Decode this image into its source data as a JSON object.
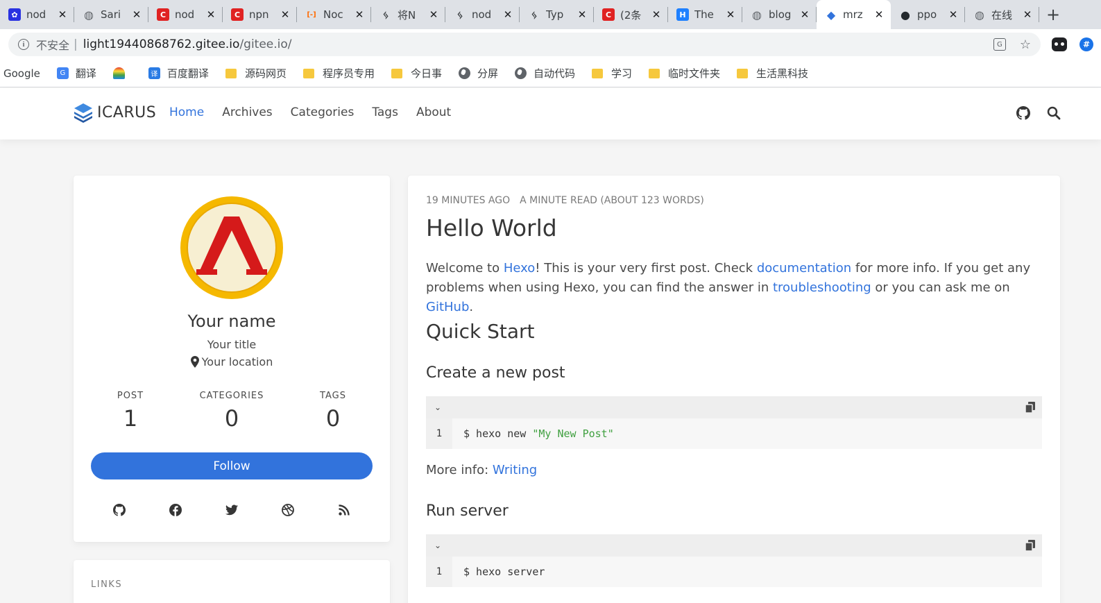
{
  "browser": {
    "tabs": [
      {
        "label": "nod",
        "icon": "baidu-paw-icon",
        "color": "#2932e1"
      },
      {
        "label": "Sari",
        "icon": "globe-icon",
        "color": "#5f6368"
      },
      {
        "label": "nod",
        "icon": "csdn-c-icon",
        "color": "#e02222"
      },
      {
        "label": "npn",
        "icon": "csdn-c-icon",
        "color": "#e02222"
      },
      {
        "label": "Noc",
        "icon": "bracket-icon",
        "color": "#ff6a00"
      },
      {
        "label": "将N",
        "icon": "yuque-bird-icon",
        "color": "#3c4043"
      },
      {
        "label": "nod",
        "icon": "yuque-bird-icon",
        "color": "#3c4043"
      },
      {
        "label": "Typ",
        "icon": "yuque-bird-icon",
        "color": "#3c4043"
      },
      {
        "label": "(2条",
        "icon": "csdn-c-icon",
        "color": "#e02222"
      },
      {
        "label": "The",
        "icon": "hex-h-icon",
        "color": "#1e80ff"
      },
      {
        "label": "blog",
        "icon": "globe-icon",
        "color": "#5f6368"
      },
      {
        "label": "mrz",
        "icon": "layers-icon",
        "color": "#3273dc"
      },
      {
        "label": "ppo",
        "icon": "github-icon",
        "color": "#24292e"
      },
      {
        "label": "在线",
        "icon": "globe-icon",
        "color": "#5f6368"
      }
    ],
    "active_tab": 11,
    "insecure_label": "不安全",
    "url_host": "light19440868762.gitee.io",
    "url_path": "/gitee.io/",
    "bookmarks": [
      {
        "label": "Google",
        "icon": "none"
      },
      {
        "label": "翻译",
        "icon": "google-translate-icon"
      },
      {
        "label": "",
        "icon": "rainbow-icon"
      },
      {
        "label": "百度翻译",
        "icon": "baidu-translate-icon"
      },
      {
        "label": "源码网页",
        "icon": "folder-icon"
      },
      {
        "label": "程序员专用",
        "icon": "folder-icon"
      },
      {
        "label": "今日事",
        "icon": "folder-icon"
      },
      {
        "label": "分屏",
        "icon": "globe-icon"
      },
      {
        "label": "自动代码",
        "icon": "globe-icon"
      },
      {
        "label": "学习",
        "icon": "folder-icon"
      },
      {
        "label": "临时文件夹",
        "icon": "folder-icon"
      },
      {
        "label": "生活黑科技",
        "icon": "folder-icon"
      }
    ]
  },
  "site": {
    "brand": "ICARUS",
    "nav": [
      "Home",
      "Archives",
      "Categories",
      "Tags",
      "About"
    ],
    "active_nav": 0,
    "accent_color": "#3273dc"
  },
  "profile": {
    "name": "Your name",
    "title": "Your title",
    "location": "Your location",
    "stats": [
      {
        "label": "POST",
        "value": "1"
      },
      {
        "label": "CATEGORIES",
        "value": "0"
      },
      {
        "label": "TAGS",
        "value": "0"
      }
    ],
    "follow_label": "Follow",
    "socials": [
      "github-icon",
      "facebook-icon",
      "twitter-icon",
      "dribbble-icon",
      "rss-icon"
    ]
  },
  "links": {
    "title": "LINKS"
  },
  "post": {
    "time": "19 MINUTES AGO",
    "read": "A MINUTE READ (ABOUT 123 WORDS)",
    "title": "Hello World",
    "intro": {
      "p1": "Welcome to ",
      "l1": "Hexo",
      "p2": "! This is your very first post. Check ",
      "l2": "documentation",
      "p3": " for more info. If you get any problems when using Hexo, you can find the answer in ",
      "l3": "troubleshooting",
      "p4": " or you can ask me on ",
      "l4": "GitHub",
      "p5": "."
    },
    "quick_start": "Quick Start",
    "create_heading": "Create a new post",
    "code1": {
      "line": "1",
      "cmd": "$ hexo new ",
      "str": "\"My New Post\""
    },
    "more_info_label": "More info: ",
    "more_info_link": "Writing",
    "run_heading": "Run server",
    "code2": {
      "line": "1",
      "cmd": "$ hexo server"
    }
  }
}
